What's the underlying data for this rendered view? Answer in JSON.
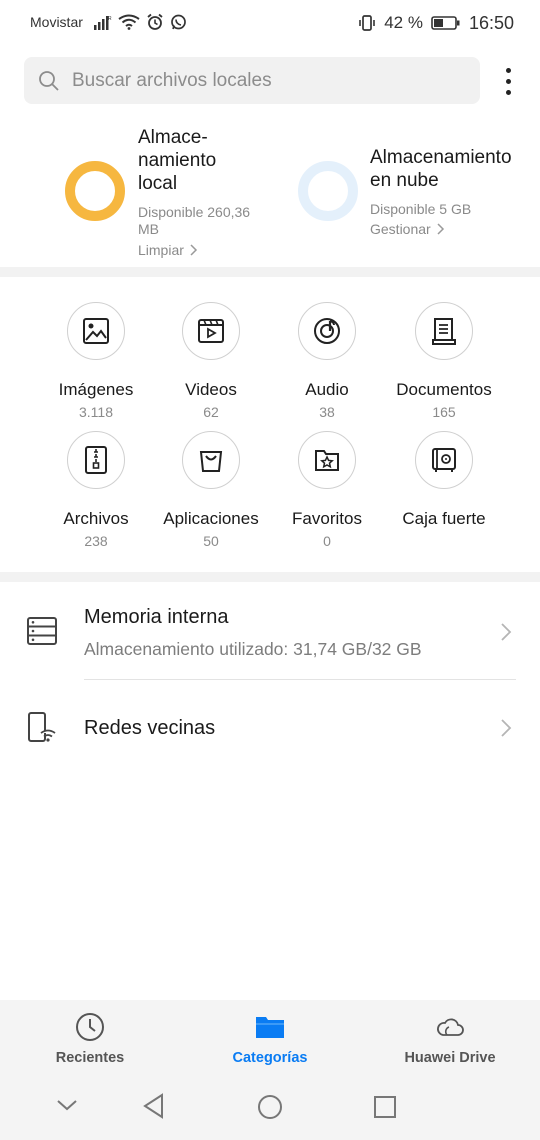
{
  "status_bar": {
    "carrier": "Movistar",
    "battery_percent": "42 %",
    "time": "16:50"
  },
  "search": {
    "placeholder": "Buscar archivos locales"
  },
  "storage": {
    "local": {
      "title_line1": "Almace-",
      "title_line2": "namiento",
      "title_line3": "local",
      "available_line1": "Disponible 260,36",
      "available_line2": "MB",
      "action": "Limpiar",
      "ring_color": "#f6b740",
      "used_fraction": 1.0
    },
    "cloud": {
      "title_line1": "Almacenamiento",
      "title_line2": "en nube",
      "available": "Disponible 5 GB",
      "action": "Gestionar",
      "ring_color": "#e4f0fb",
      "used_fraction": 0.0
    }
  },
  "categories": [
    {
      "label": "Imágenes",
      "count": "3.118",
      "icon": "image-icon"
    },
    {
      "label": "Videos",
      "count": "62",
      "icon": "video-icon"
    },
    {
      "label": "Audio",
      "count": "38",
      "icon": "audio-icon"
    },
    {
      "label": "Documentos",
      "count": "165",
      "icon": "document-icon"
    },
    {
      "label": "Archivos",
      "count": "238",
      "icon": "archive-icon"
    },
    {
      "label": "Aplicaciones",
      "count": "50",
      "icon": "shopping-bag-icon"
    },
    {
      "label": "Favoritos",
      "count": "0",
      "icon": "star-folder-icon"
    },
    {
      "label": "Caja fuerte",
      "count": "",
      "icon": "safe-icon"
    }
  ],
  "list": {
    "internal_memory": {
      "title": "Memoria interna",
      "subtitle": "Almacenamiento utilizado: 31,74 GB/32 GB"
    },
    "nearby_networks": {
      "title": "Redes vecinas"
    }
  },
  "bottom_nav": {
    "tabs": [
      {
        "label": "Recientes",
        "icon": "clock-icon",
        "active": false
      },
      {
        "label": "Categorías",
        "icon": "folder-icon",
        "active": true
      },
      {
        "label": "Huawei Drive",
        "icon": "cloud-icon",
        "active": false
      }
    ]
  },
  "colors": {
    "accent": "#0a7cf3",
    "local_ring": "#f6b740",
    "cloud_ring": "#e4f0fb"
  }
}
